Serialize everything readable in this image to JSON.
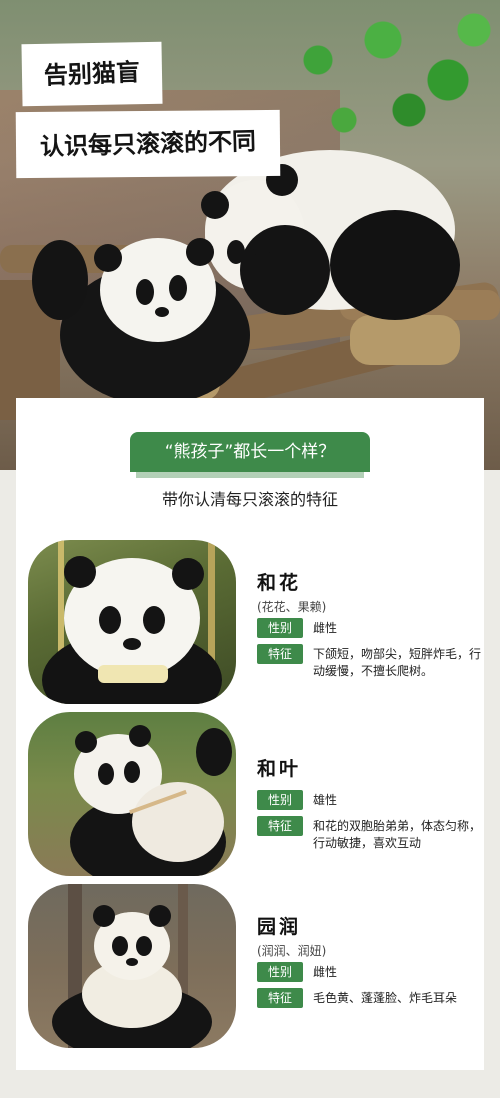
{
  "hero": {
    "title_line1": "告别猫盲",
    "title_line2": "认识每只滚滚的不同"
  },
  "intro": {
    "badge": "“熊孩子”都长一个样？",
    "subtitle": "带你认清每只滚滚的特征"
  },
  "labels": {
    "gender": "性别",
    "feature": "特征"
  },
  "pandas": [
    {
      "name": "和花",
      "alias": "(花花、果赖)",
      "gender": "雌性",
      "feature": "下颌短，吻部尖，短胖炸毛，行动缓慢，不擅长爬树。"
    },
    {
      "name": "和叶",
      "gender": "雄性",
      "feature": "和花的双胞胎弟弟，体态匀称，行动敏捷，喜欢互动"
    },
    {
      "name": "园润",
      "alias": "(润润、润妞)",
      "gender": "雌性",
      "feature": "毛色黄、蓬蓬脸、炸毛耳朵"
    }
  ]
}
